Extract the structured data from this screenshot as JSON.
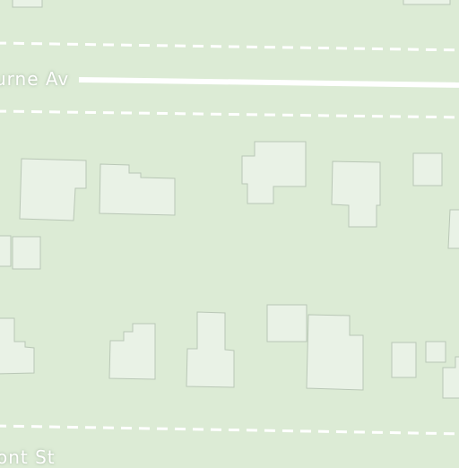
{
  "map": {
    "background_color": "#dcebd5",
    "building_color": "#e9f2e6",
    "road_color": "#ffffff",
    "streets": [
      {
        "id": "upper",
        "label": "urne Av"
      },
      {
        "id": "lower",
        "label": "ont St"
      }
    ]
  }
}
